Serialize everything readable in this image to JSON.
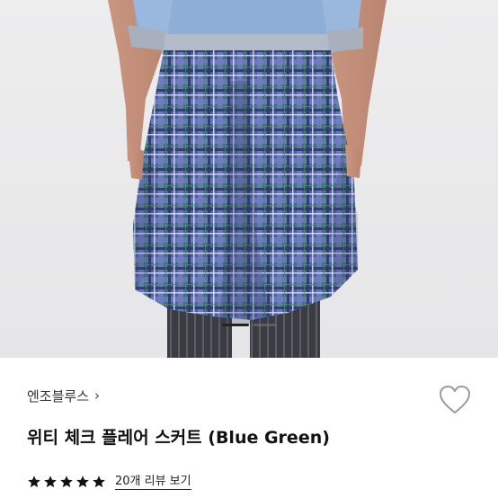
{
  "product": {
    "brand": "엔조블루스",
    "brand_chevron": "›",
    "title": "위티 체크 플레어 스커트 (Blue Green)",
    "rating": 5,
    "reviews_label": "20개 리뷰 보기"
  },
  "gallery": {
    "current_slide": 1,
    "slide_count": 2
  },
  "icons": {
    "like": "heart-outline-icon",
    "star": "star-icon",
    "chevron": "chevron-right-icon"
  },
  "colors": {
    "star": "#111111",
    "text": "#111111",
    "skirt_base": "#4d5c9a"
  }
}
